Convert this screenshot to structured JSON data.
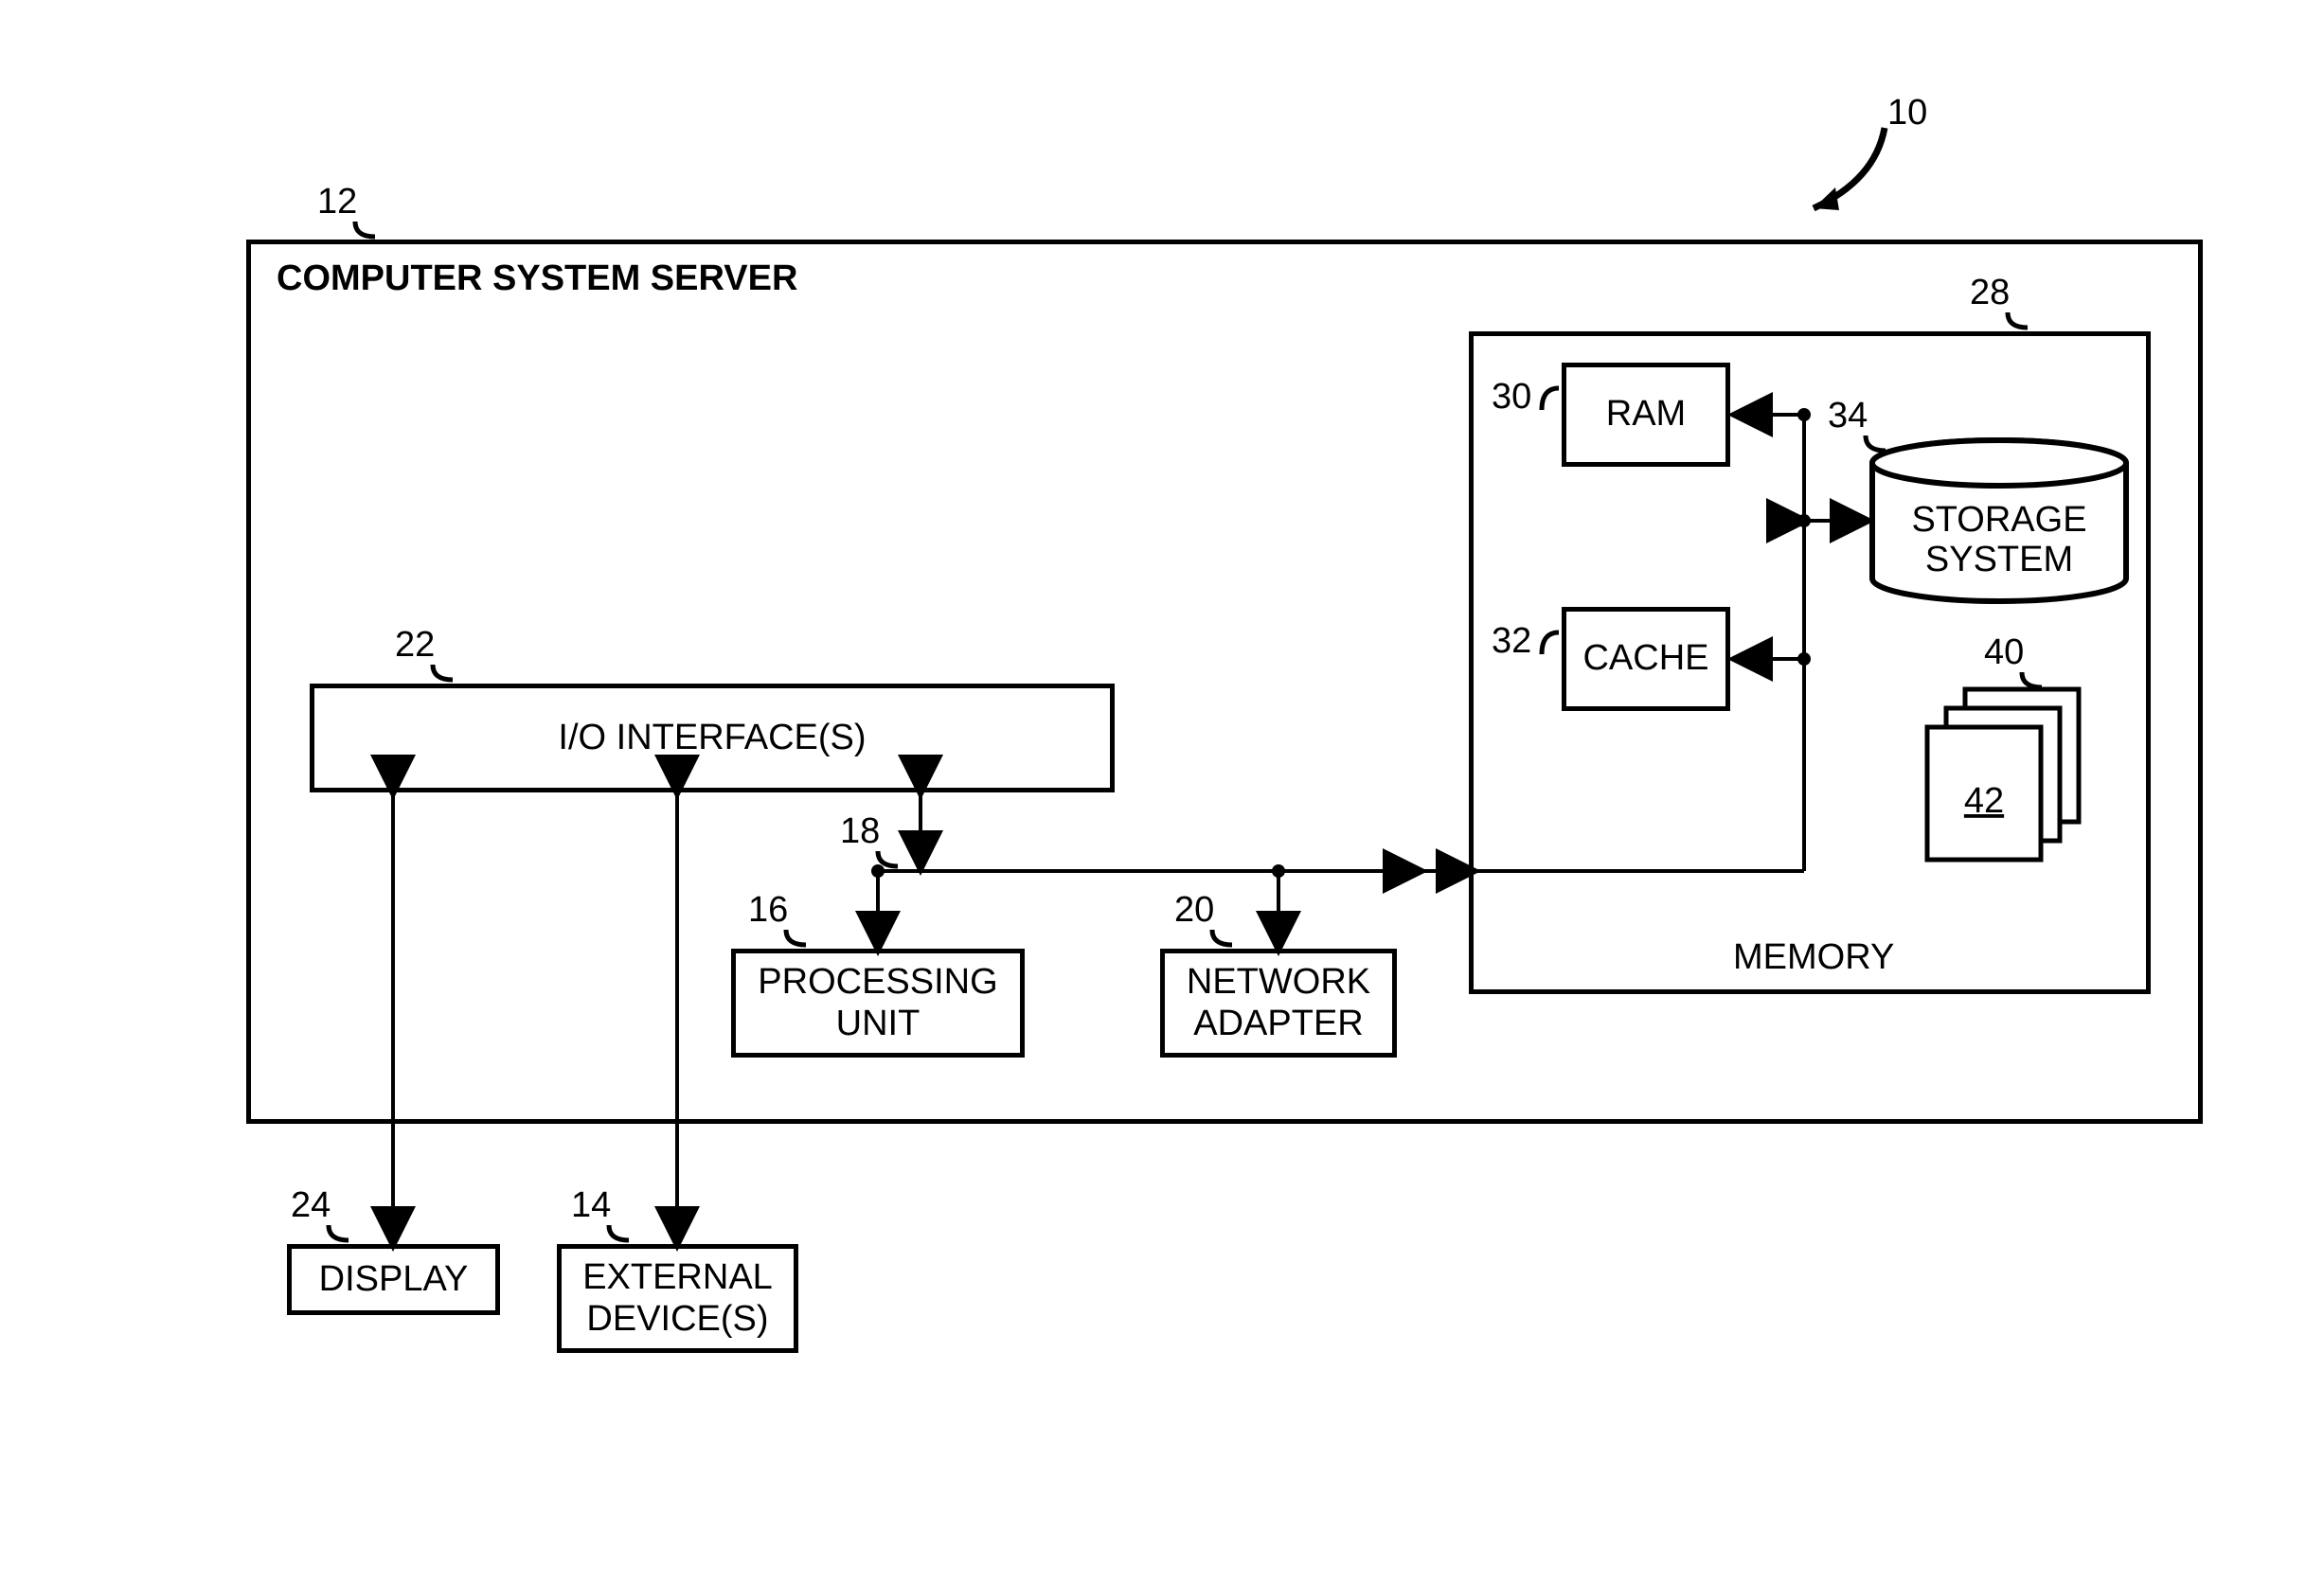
{
  "refs": {
    "system": "10",
    "server": "12",
    "external_devices": "14",
    "processing_unit": "16",
    "bus": "18",
    "network_adapter": "20",
    "io_interfaces": "22",
    "display": "24",
    "memory": "28",
    "ram": "30",
    "cache": "32",
    "storage_system": "34",
    "program_modules": "40",
    "program_module_item": "42"
  },
  "labels": {
    "server_title": "COMPUTER SYSTEM SERVER",
    "io_interfaces": "I/O INTERFACE(S)",
    "processing_unit": "PROCESSING\nUNIT",
    "network_adapter": "NETWORK\nADAPTER",
    "display": "DISPLAY",
    "external_devices": "EXTERNAL\nDEVICE(S)",
    "memory": "MEMORY",
    "ram": "RAM",
    "cache": "CACHE",
    "storage_system": "STORAGE\nSYSTEM"
  }
}
